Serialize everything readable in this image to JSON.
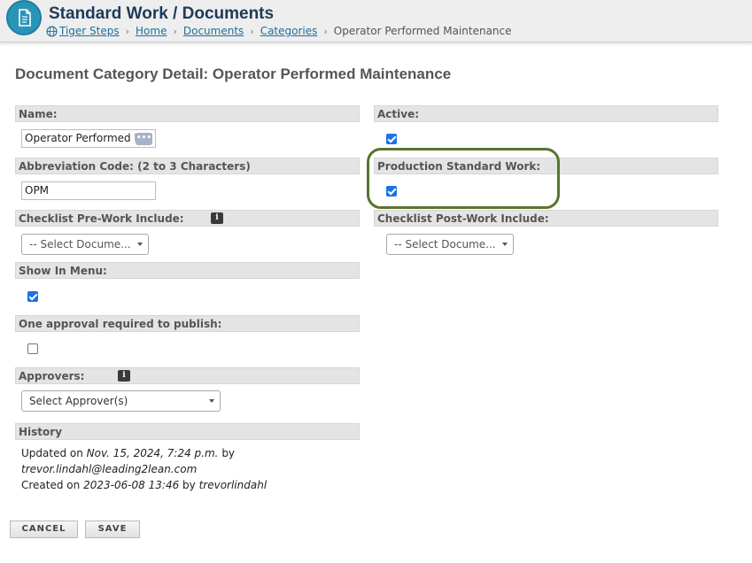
{
  "header": {
    "title": "Standard Work / Documents",
    "breadcrumb": {
      "home_site": "Tiger Steps",
      "home": "Home",
      "documents": "Documents",
      "categories": "Categories",
      "current": "Operator Performed Maintenance"
    }
  },
  "page": {
    "title": "Document Category Detail: Operator Performed Maintenance"
  },
  "fields": {
    "name": {
      "label": "Name:",
      "value": "Operator Performed Mai"
    },
    "abbreviation": {
      "label": "Abbreviation Code: (2 to 3 Characters)",
      "value": "OPM"
    },
    "checklist_pre": {
      "label": "Checklist Pre-Work Include:",
      "placeholder": "-- Select Docume..."
    },
    "show_in_menu": {
      "label": "Show In Menu:",
      "checked": true
    },
    "one_approval": {
      "label": "One approval required to publish:",
      "checked": false
    },
    "approvers": {
      "label": "Approvers:",
      "placeholder": "Select Approver(s)"
    },
    "active": {
      "label": "Active:",
      "checked": true
    },
    "production_standard_work": {
      "label": "Production Standard Work:",
      "checked": true
    },
    "checklist_post": {
      "label": "Checklist Post-Work Include:",
      "placeholder": "-- Select Docume..."
    }
  },
  "history": {
    "label": "History",
    "updated_prefix": "Updated on ",
    "updated_date": "Nov. 15, 2024, 7:24 p.m.",
    "updated_by_word": " by",
    "updated_user": "trevor.lindahl@leading2lean.com",
    "created_prefix": "Created on ",
    "created_date": "2023-06-08 13:46",
    "created_by_word": " by ",
    "created_user": "trevorlindahl"
  },
  "buttons": {
    "cancel": "CANCEL",
    "save": "SAVE"
  },
  "icons": {
    "app": "document-icon",
    "breadcrumb_site": "globe-icon",
    "info": "info-icon"
  },
  "colors": {
    "app_icon": "#2a94b8",
    "title": "#1e3a5a",
    "link": "#1e6f96",
    "checkbox": "#1a73e8",
    "highlight": "#58742e"
  }
}
